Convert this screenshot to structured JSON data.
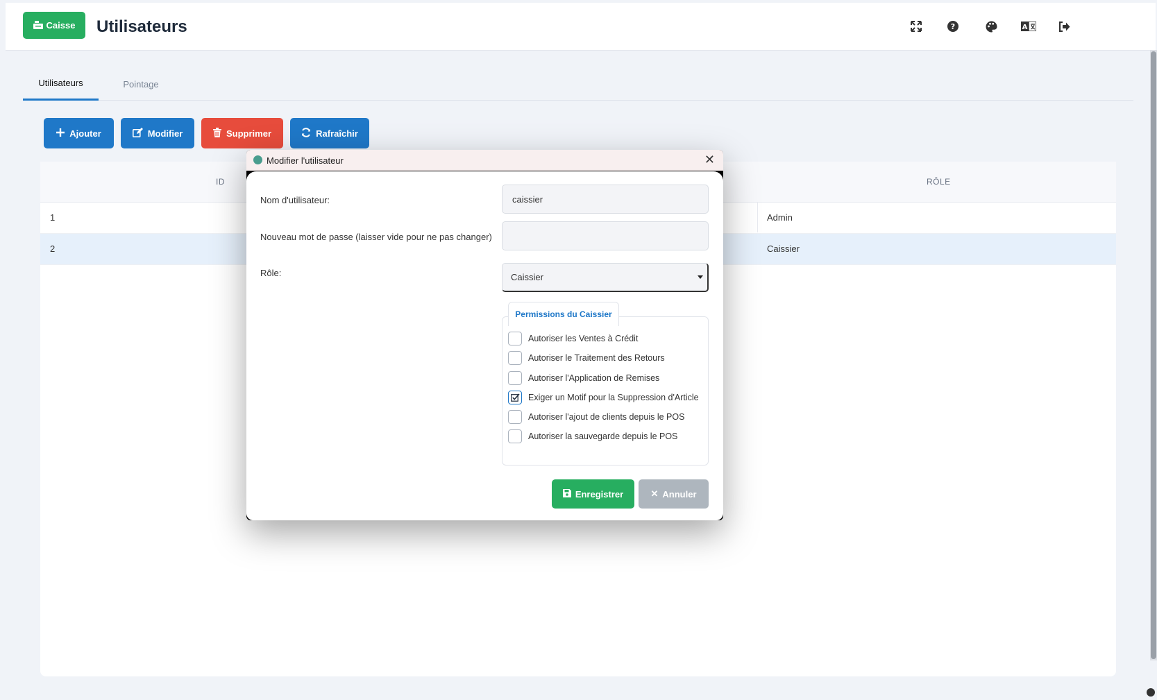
{
  "header": {
    "caisse_label": "Caisse",
    "title": "Utilisateurs",
    "icons": [
      "fullscreen-icon",
      "help-icon",
      "palette-icon",
      "language-icon",
      "logout-icon"
    ]
  },
  "tabs": [
    {
      "label": "Utilisateurs",
      "active": true
    },
    {
      "label": "Pointage",
      "active": false
    }
  ],
  "toolbar": {
    "add_label": "Ajouter",
    "edit_label": "Modifier",
    "delete_label": "Supprimer",
    "refresh_label": "Rafraîchir"
  },
  "table": {
    "columns": [
      "ID",
      "RÔLE"
    ],
    "rows": [
      {
        "id": "1",
        "role": "Admin"
      },
      {
        "id": "2",
        "role": "Caissier"
      }
    ]
  },
  "dialog": {
    "title": "Modifier l'utilisateur",
    "username_label": "Nom d'utilisateur:",
    "username_value": "caissier",
    "password_label": "Nouveau mot de passe (laisser vide pour ne pas changer)",
    "password_value": "",
    "role_label": "Rôle:",
    "role_value": "Caissier",
    "permissions_title": "Permissions du Caissier",
    "permissions": [
      {
        "label": "Autoriser les Ventes à Crédit",
        "checked": false
      },
      {
        "label": "Autoriser le Traitement des Retours",
        "checked": false
      },
      {
        "label": "Autoriser l'Application de Remises",
        "checked": false
      },
      {
        "label": "Exiger un Motif pour la Suppression d'Article",
        "checked": true
      },
      {
        "label": "Autoriser l'ajout de clients depuis le POS",
        "checked": false
      },
      {
        "label": "Autoriser la sauvegarde depuis le POS",
        "checked": false
      }
    ],
    "save_label": "Enregistrer",
    "cancel_label": "Annuler"
  },
  "colors": {
    "accent": "#1f78c8",
    "success": "#27ae60",
    "danger": "#e74c3c",
    "muted": "#aeb6be"
  }
}
